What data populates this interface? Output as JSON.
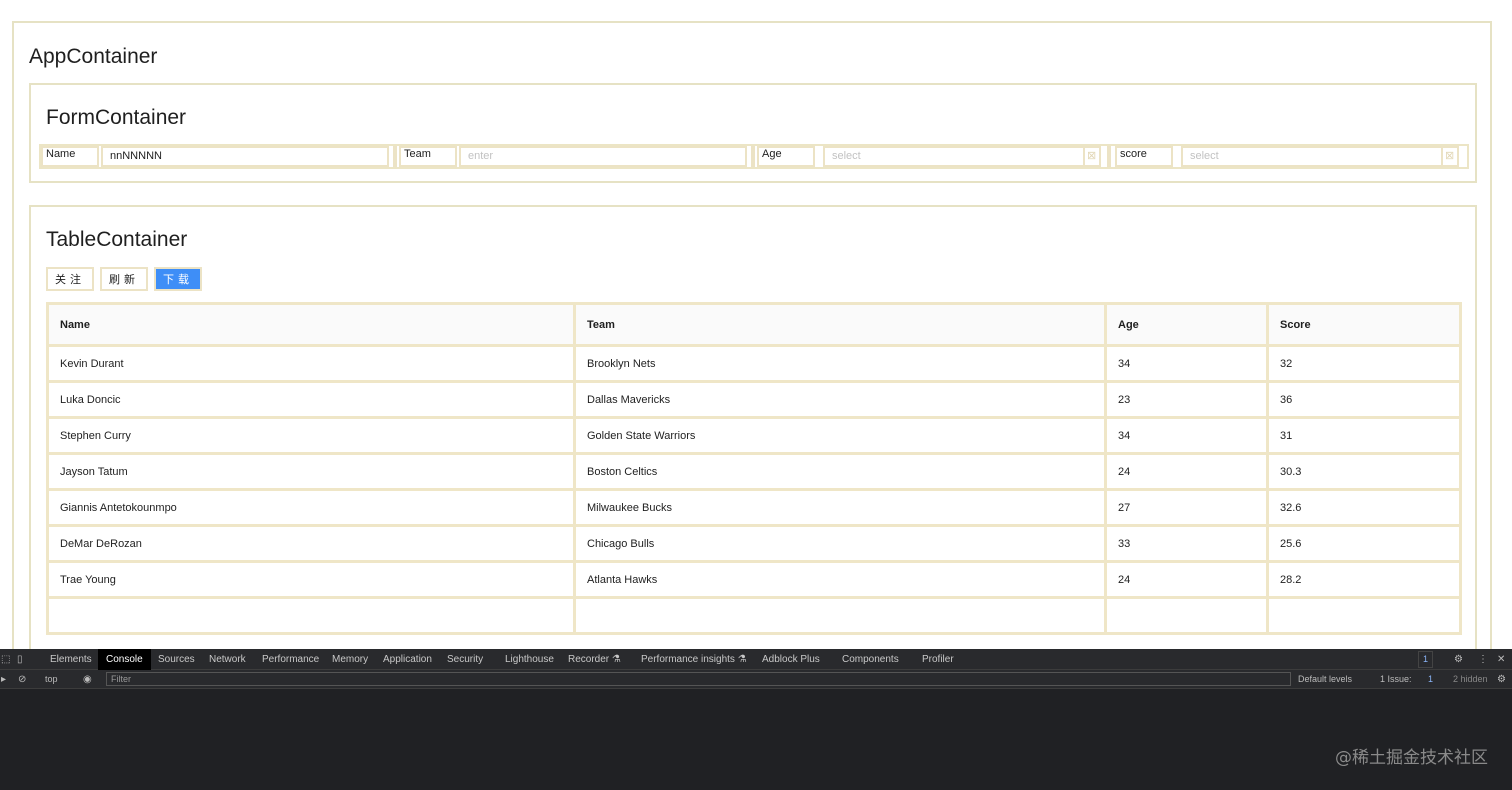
{
  "app": {
    "title": "AppContainer"
  },
  "form": {
    "title": "FormContainer",
    "fields": [
      {
        "label": "Name",
        "value": "nnNNNNN",
        "placeholder": ""
      },
      {
        "label": "Team",
        "value": "",
        "placeholder": "enter"
      },
      {
        "label": "Age",
        "value": "",
        "placeholder": "select"
      },
      {
        "label": "score",
        "value": "",
        "placeholder": "select"
      }
    ]
  },
  "table": {
    "title": "TableContainer",
    "buttons": {
      "follow": "关注",
      "refresh": "刷新",
      "download": "下载"
    },
    "columns": [
      "Name",
      "Team",
      "Age",
      "Score"
    ],
    "rows": [
      [
        "Kevin Durant",
        "Brooklyn Nets",
        "34",
        "32"
      ],
      [
        "Luka Doncic",
        "Dallas Mavericks",
        "23",
        "36"
      ],
      [
        "Stephen Curry",
        "Golden State Warriors",
        "34",
        "31"
      ],
      [
        "Jayson Tatum",
        "Boston Celtics",
        "24",
        "30.3"
      ],
      [
        "Giannis Antetokounmpo",
        "Milwaukee Bucks",
        "27",
        "32.6"
      ],
      [
        "DeMar DeRozan",
        "Chicago Bulls",
        "33",
        "25.6"
      ],
      [
        "Trae Young",
        "Atlanta Hawks",
        "24",
        "28.2"
      ]
    ]
  },
  "devtools": {
    "tabs": [
      "Elements",
      "Console",
      "Sources",
      "Network",
      "Performance",
      "Memory",
      "Application",
      "Security",
      "Lighthouse",
      "Recorder ⚗",
      "Performance insights ⚗",
      "Adblock Plus",
      "Components",
      "Profiler"
    ],
    "active_tab": "Console",
    "messages_badge": "1",
    "context": "top",
    "filter_placeholder": "Filter",
    "levels": "Default levels",
    "issues": "1 Issue:",
    "issues_count": "1",
    "hidden": "2 hidden"
  },
  "watermark": "@稀土掘金技术社区",
  "colors": {
    "primary_button": "#3e8ef7",
    "border": "#e6e2c4",
    "devtools_bg": "#202124"
  }
}
